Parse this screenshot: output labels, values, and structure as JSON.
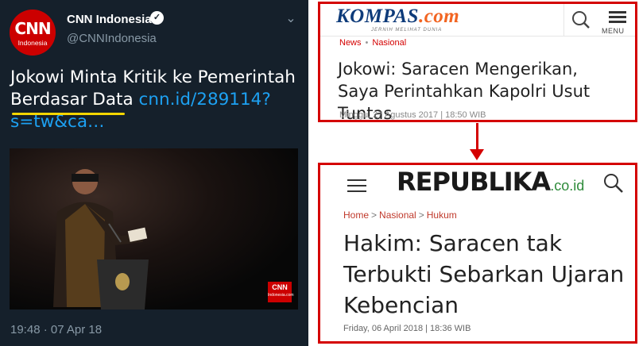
{
  "tweet": {
    "avatar_logo": "CNN",
    "avatar_sub": "Indonesia",
    "account_name": "CNN Indonesia",
    "handle": "@CNNIndonesia",
    "text": "Jokowi Minta Kritik ke Pemerintah Berdasar Data",
    "link": "cnn.id/289114?s=tw&ca…",
    "photo_badge": "CNN",
    "photo_badge_sub": "Indonesia.com",
    "timestamp": "19:48 · 07 Apr 18",
    "colors": {
      "background": "#15202b",
      "link": "#1da1f2",
      "highlight": "#f5d600"
    },
    "icons": [
      "verified-icon",
      "chevron-down-icon"
    ]
  },
  "kompas": {
    "logo": "KOMPAS",
    "logo_domain": ".com",
    "tagline": "JERNIH MELIHAT DUNIA",
    "menu_label": "MENU",
    "breadcrumb": [
      "News",
      "Nasional"
    ],
    "headline": "Jokowi: Saracen Mengerikan, Saya Perintahkan Kapolri Usut Tuntas",
    "date": "Minggu, 27 Agustus 2017 | 18:50 WIB",
    "colors": {
      "brand": "#0e3b7a",
      "accent": "#f26522"
    },
    "icons": [
      "search-icon",
      "menu-icon"
    ]
  },
  "republika": {
    "logo": "REPUBLIKA",
    "logo_domain": ".co.id",
    "breadcrumb": [
      "Home",
      "Nasional",
      "Hukum"
    ],
    "headline": "Hakim: Saracen tak Terbukti Sebarkan Ujaran Kebencian",
    "date": "Friday, 06 April 2018 | 18:36 WIB",
    "colors": {
      "domain": "#2e8b3a",
      "crumb": "#c0392b"
    },
    "icons": [
      "hamburger-icon",
      "search-icon"
    ]
  },
  "frame_color": "#d40000"
}
